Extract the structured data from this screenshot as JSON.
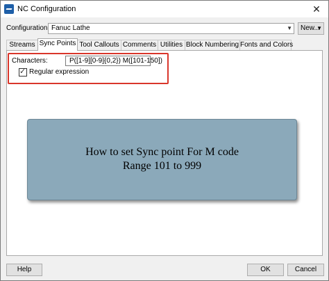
{
  "window": {
    "title": "NC Configuration",
    "close_glyph": "✕",
    "icon": "app-icon"
  },
  "configurations": {
    "label": "Configurations:",
    "selected": "Fanuc Lathe",
    "new_label": "New..."
  },
  "tabs": [
    {
      "label": "Streams",
      "active": false
    },
    {
      "label": "Sync Points",
      "active": true
    },
    {
      "label": "Tool Callouts",
      "active": false
    },
    {
      "label": "Comments",
      "active": false
    },
    {
      "label": "Utilities",
      "active": false
    },
    {
      "label": "Block Numbering",
      "active": false
    },
    {
      "label": "Fonts and Colors",
      "active": false
    }
  ],
  "sync_points": {
    "characters_label": "Characters:",
    "characters_value": "P([1-9][0-9]{0,2}) M([101-150])",
    "regex_checked": true,
    "regex_label": "Regular expression"
  },
  "annotation": {
    "line1": "How to set Sync point For M code",
    "line2": "Range 101 to 999",
    "highlight_color": "#d9362b"
  },
  "footer": {
    "help_label": "Help",
    "ok_label": "OK",
    "cancel_label": "Cancel"
  }
}
